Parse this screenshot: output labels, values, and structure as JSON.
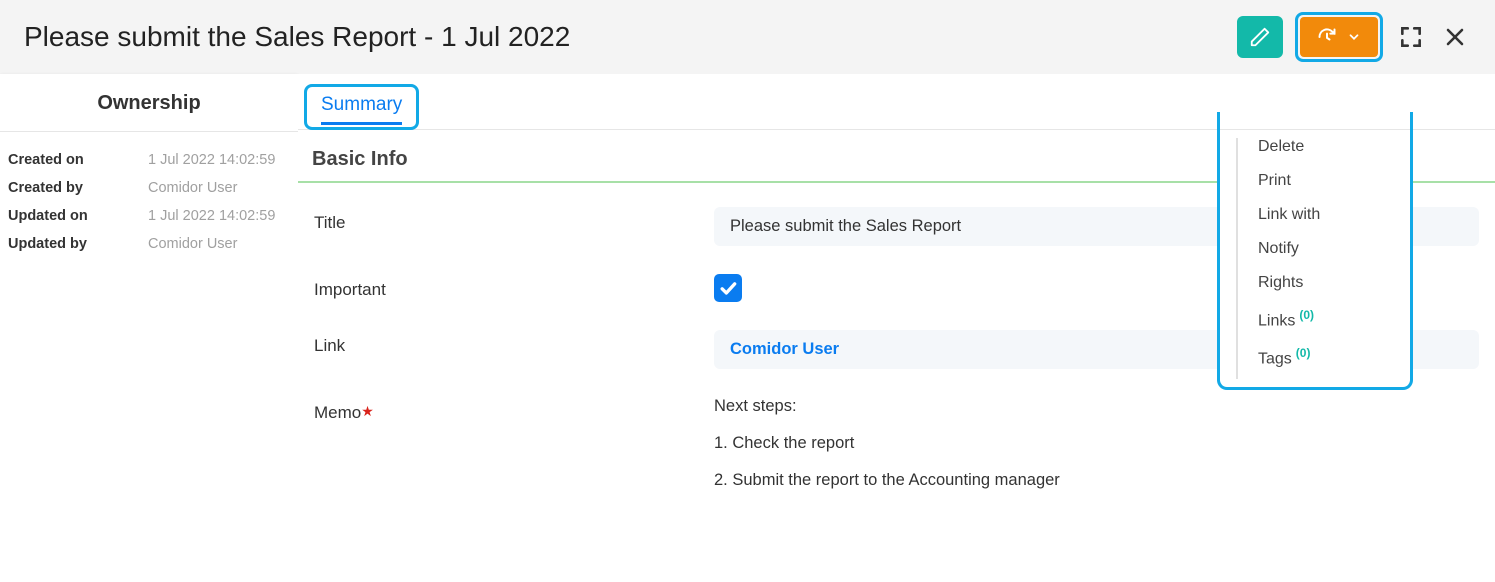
{
  "header": {
    "title": "Please submit the Sales Report - 1 Jul 2022"
  },
  "ownership": {
    "panel_title": "Ownership",
    "rows": [
      {
        "label": "Created on",
        "value": "1 Jul 2022 14:02:59"
      },
      {
        "label": "Created by",
        "value": "Comidor User"
      },
      {
        "label": "Updated on",
        "value": "1 Jul 2022 14:02:59"
      },
      {
        "label": "Updated by",
        "value": "Comidor User"
      }
    ]
  },
  "tabs": {
    "summary": "Summary"
  },
  "section": {
    "basic_info": "Basic Info"
  },
  "form": {
    "title_label": "Title",
    "title_value": "Please submit the Sales Report",
    "important_label": "Important",
    "link_label": "Link",
    "link_value": "Comidor User",
    "memo_label": "Memo",
    "memo_lines": {
      "l0": "Next steps:",
      "l1": "1. Check the report",
      "l2": "2. Submit the report to the Accounting manager"
    }
  },
  "dropdown": {
    "delete": "Delete",
    "print": "Print",
    "link_with": "Link with",
    "notify": "Notify",
    "rights": "Rights",
    "links": "Links",
    "links_count": "(0)",
    "tags": "Tags",
    "tags_count": "(0)"
  }
}
